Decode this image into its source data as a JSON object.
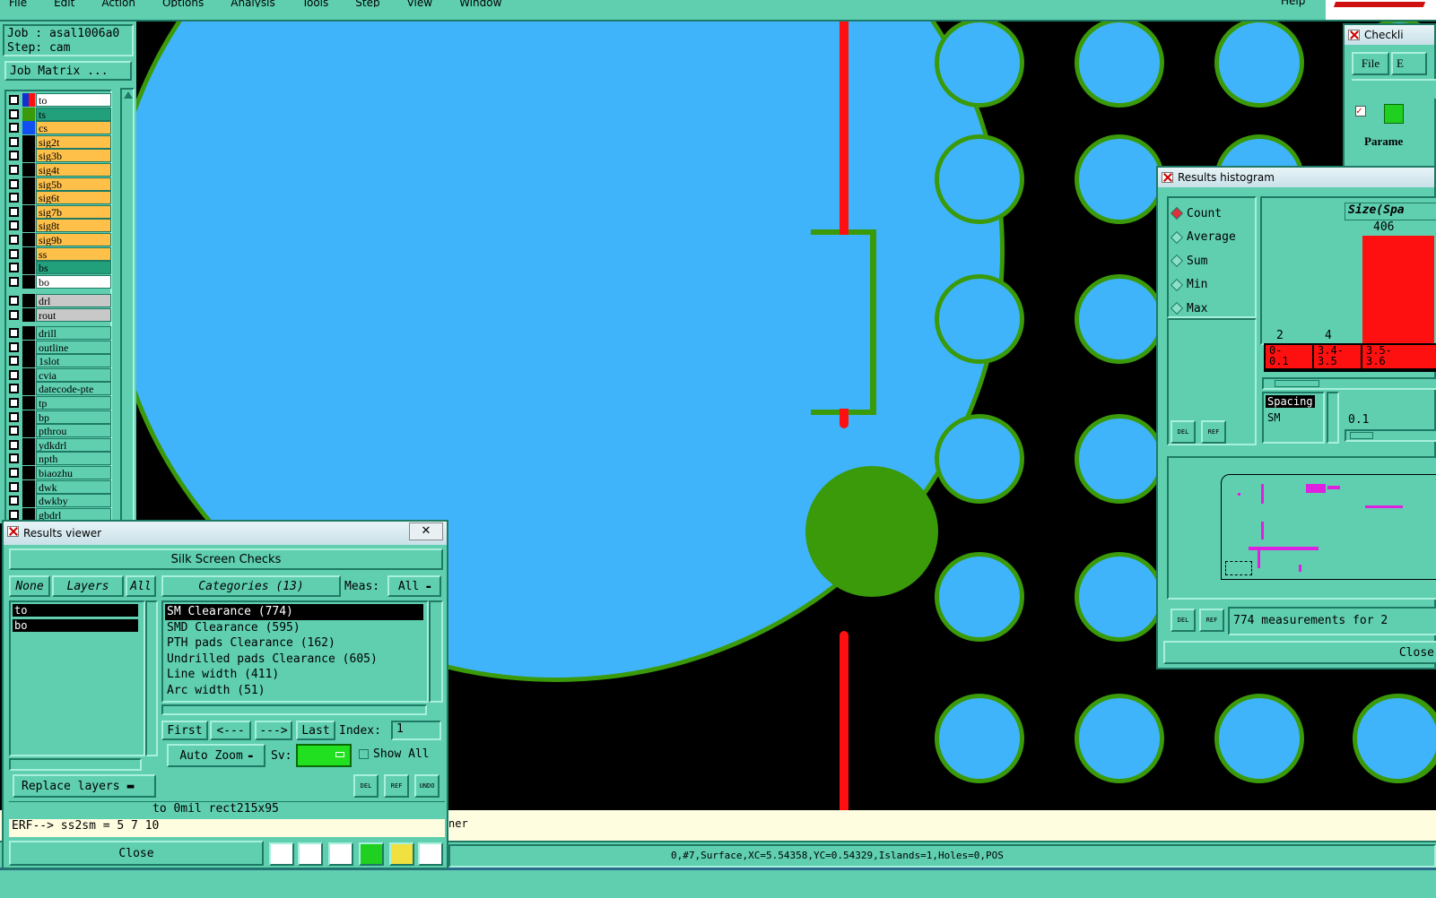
{
  "menu": {
    "items": [
      "File",
      "Edit",
      "Action",
      "Options",
      "Analysis",
      "Tools",
      "Step",
      "View",
      "Window"
    ],
    "help": "Help"
  },
  "job": {
    "job_line": "Job : asal1006a0",
    "step_line": "Step: cam",
    "matrix_btn": "Job Matrix ..."
  },
  "layers": [
    {
      "name": "to",
      "bg": "#ffffff"
    },
    {
      "name": "ts",
      "bg": "#22a07c"
    },
    {
      "name": "cs",
      "bg": "#ffc04a"
    },
    {
      "name": "sig2t",
      "bg": "#ffc04a"
    },
    {
      "name": "sig3b",
      "bg": "#ffc04a"
    },
    {
      "name": "sig4t",
      "bg": "#ffc04a"
    },
    {
      "name": "sig5b",
      "bg": "#ffc04a"
    },
    {
      "name": "sig6t",
      "bg": "#ffc04a"
    },
    {
      "name": "sig7b",
      "bg": "#ffc04a"
    },
    {
      "name": "sig8t",
      "bg": "#ffc04a"
    },
    {
      "name": "sig9b",
      "bg": "#ffc04a"
    },
    {
      "name": "ss",
      "bg": "#ffc04a"
    },
    {
      "name": "bs",
      "bg": "#22a07c"
    },
    {
      "name": "bo",
      "bg": "#ffffff"
    }
  ],
  "layers2": [
    {
      "name": "drl",
      "bg": "#c8c8c8"
    },
    {
      "name": "rout",
      "bg": "#c8c8c8"
    }
  ],
  "layers3": [
    "drill",
    "outline",
    "1slot",
    "cvia",
    "datecode-pte",
    "tp",
    "bp",
    "pthrou",
    "ydkdrl",
    "npth",
    "biaozhu",
    "dwk",
    "dwkby",
    "gbdrl"
  ],
  "colors": {
    "teal": "#5fcfb0",
    "pad": "#40b4fa",
    "ring": "#3a9a0a",
    "trace": "#ff1010",
    "canvas": "#000000"
  },
  "results_viewer": {
    "title": "Results viewer",
    "header": "Silk Screen Checks",
    "none_btn": "None",
    "layers_btn": "Layers",
    "all_btn": "All",
    "categories_btn": "Categories (13)",
    "meas_label": "Meas:",
    "meas_value": "All",
    "layer_list": [
      "to",
      "bo"
    ],
    "categories": [
      "SM Clearance (774)",
      "SMD Clearance (595)",
      "PTH pads Clearance (162)",
      "Undrilled pads Clearance (605)",
      "Line width (411)",
      "Arc width (51)"
    ],
    "first": "First",
    "prev": "<---",
    "next": "--->",
    "last": "Last",
    "index_label": "Index:",
    "index_value": "1",
    "auto_zoom": "Auto Zoom",
    "sv_label": "Sv:",
    "show_all": "Show All",
    "replace_layers": "Replace layers",
    "del": "DEL",
    "ref": "REF",
    "undo": "UNDO",
    "status_line": "to 0mil   rect215x95",
    "erf_line": "ERF--> ss2sm = 5 7 10",
    "close": "Close"
  },
  "histogram": {
    "title": "Results histogram",
    "modes": [
      "Count",
      "Average",
      "Sum",
      "Min",
      "Max"
    ],
    "size_label": "Size(Spa",
    "bar_value": "406",
    "axis_small": [
      "2",
      "4"
    ],
    "bins": [
      "0-\n0.1",
      "3.4-\n3.5",
      "3.5-\n3.6"
    ],
    "spacing_label": "Spacing",
    "sm_label": "SM",
    "slider_value": "0.1",
    "del": "DEL",
    "ref": "REF",
    "summary": "774 measurements for 2",
    "close": "Close"
  },
  "checklist": {
    "title": "Checkli",
    "file": "File",
    "edit": "E",
    "param": "Parame"
  },
  "bottom": {
    "coords": "0,#7,Surface,XC=5.54358,YC=0.54329,Islands=1,Holes=0,POS",
    "partial": "ner"
  }
}
